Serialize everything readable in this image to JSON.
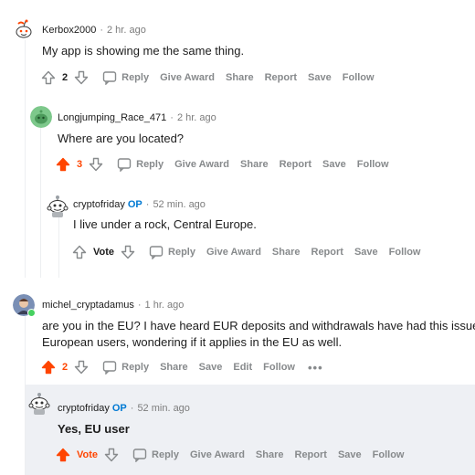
{
  "comments": [
    {
      "author": "Kerbox2000",
      "time": "2 hr. ago",
      "text": "My app is showing me the same thing.",
      "votes": "2",
      "upvoted": false,
      "actions": [
        "Reply",
        "Give Award",
        "Share",
        "Report",
        "Save",
        "Follow"
      ]
    },
    {
      "author": "Longjumping_Race_471",
      "time": "2 hr. ago",
      "text": "Where are you located?",
      "votes": "3",
      "upvoted": true,
      "actions": [
        "Reply",
        "Give Award",
        "Share",
        "Report",
        "Save",
        "Follow"
      ]
    },
    {
      "author": "cryptofriday",
      "op_badge": "OP",
      "time": "52 min. ago",
      "text": "I live under a rock, Central Europe.",
      "votes": "Vote",
      "upvoted": false,
      "actions": [
        "Reply",
        "Give Award",
        "Share",
        "Report",
        "Save",
        "Follow"
      ]
    },
    {
      "author": "michel_cryptadamus",
      "time": "1 hr. ago",
      "text_line1": "are you in the EU? I have heard EUR deposits and withdrawals have had this issue",
      "text_line2": "European users, wondering if it applies in the EU as well.",
      "votes": "2",
      "upvoted": true,
      "actions": [
        "Reply",
        "Share",
        "Save",
        "Edit",
        "Follow"
      ],
      "more": "•••"
    },
    {
      "author": "cryptofriday",
      "op_badge": "OP",
      "time": "52 min. ago",
      "text": "Yes, EU user",
      "votes": "Vote",
      "upvoted": true,
      "actions": [
        "Reply",
        "Give Award",
        "Share",
        "Report",
        "Save",
        "Follow"
      ]
    }
  ],
  "colors": {
    "upvote": "#ff4500",
    "op": "#0079d3",
    "meta": "#7c7c7c",
    "action": "#878a8c",
    "highlight": "#eef0f4"
  }
}
